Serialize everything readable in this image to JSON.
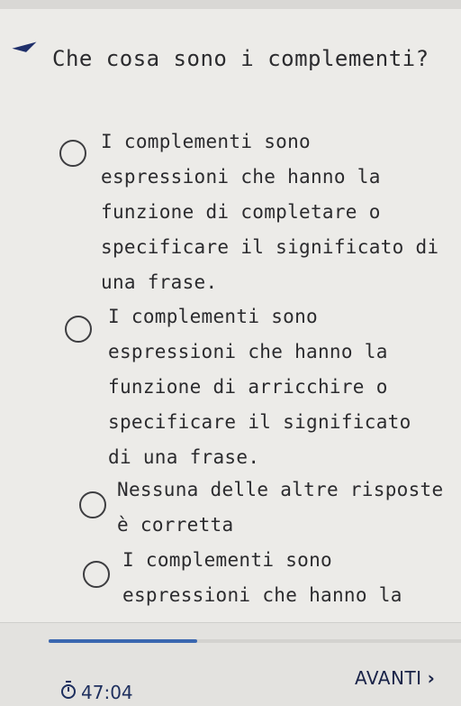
{
  "question": {
    "text": "Che cosa sono i complementi?"
  },
  "options": [
    {
      "label": "I complementi sono espressioni che hanno la funzione di completare o specificare il significato di una frase.",
      "selected": false
    },
    {
      "label": "I complementi sono espressioni che hanno la funzione di arricchire o specificare il significato di una frase.",
      "selected": false
    },
    {
      "label": "Nessuna delle altre risposte è corretta",
      "selected": false
    },
    {
      "label": "I complementi sono espressioni che hanno la",
      "selected": false
    }
  ],
  "footer": {
    "timer": "47:04",
    "timer_icon": "stopwatch-icon",
    "next_label": "AVANTI",
    "progress_fraction": 0.36
  },
  "colors": {
    "accent": "#3a67b0",
    "text": "#2b2b2e"
  }
}
